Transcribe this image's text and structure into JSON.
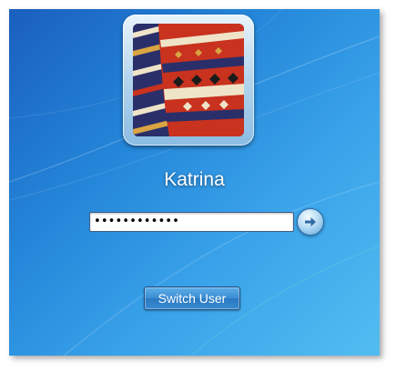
{
  "login": {
    "user_name": "Katrina",
    "password_value": "••••••••••••",
    "go_button_icon": "arrow-right-icon",
    "switch_user_label": "Switch User"
  },
  "avatar": {
    "icon": "user-picture-textile",
    "colors": {
      "red": "#c8321e",
      "blue": "#2a3a7a",
      "cream": "#efe4c8"
    }
  },
  "theme": {
    "background_top": "#1a5fbe",
    "background_bottom": "#52bdf1"
  }
}
